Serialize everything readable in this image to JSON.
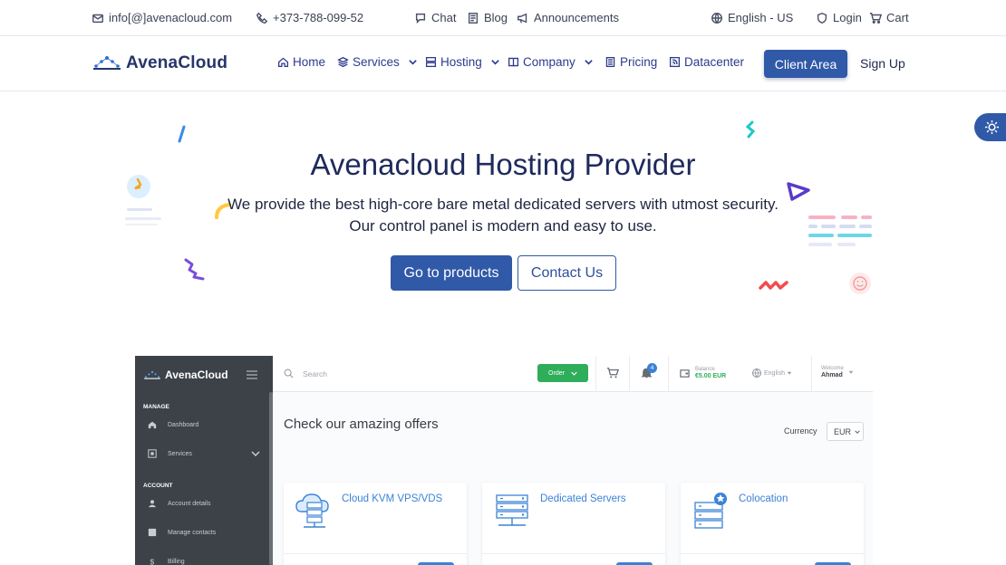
{
  "topbar": {
    "email": "info[@]avenacloud.com",
    "phone": "+373-788-099-52",
    "chat": "Chat",
    "blog": "Blog",
    "announcements": "Announcements",
    "language": "English - US",
    "login": "Login",
    "cart": "Cart"
  },
  "nav": {
    "logo": "AvenaCloud",
    "items": [
      {
        "label": "Home",
        "icon": "home-icon"
      },
      {
        "label": "Services",
        "icon": "layers-icon"
      },
      {
        "label": "Hosting",
        "icon": "server-icon"
      },
      {
        "label": "Company",
        "icon": "book-icon"
      },
      {
        "label": "Pricing",
        "icon": "document-icon"
      },
      {
        "label": "Datacenter",
        "icon": "rss-icon"
      }
    ],
    "client_area": "Client Area",
    "sign_up": "Sign Up"
  },
  "hero": {
    "title": "Avenacloud Hosting Provider",
    "subtitle": "We provide the best high-core bare metal dedicated servers with utmost security. Our control panel is modern and easy to use.",
    "primary_button": "Go to products",
    "secondary_button": "Contact Us"
  },
  "preview": {
    "logo": "AvenaCloud",
    "sidebar": {
      "manage_section": "MANAGE",
      "account_section": "ACCOUNT",
      "links": [
        "Dashboard",
        "Services",
        "Account details",
        "Manage contacts",
        "Billing"
      ]
    },
    "topbar": {
      "search_placeholder": "Search",
      "order": "Order",
      "notifications": "4",
      "balance_label": "Balance",
      "balance_value": "€5.00 EUR",
      "language": "English",
      "welcome_label": "Welcome",
      "user": "Ahmad"
    },
    "main_title": "Check our amazing offers",
    "currency_label": "Currency",
    "currency_value": "EUR",
    "cards": [
      "Cloud KVM VPS/VDS",
      "Dedicated Servers",
      "Colocation"
    ]
  },
  "colors": {
    "primary": "#3059a8",
    "navy": "#1e2a5c",
    "order_green": "#2eae5a",
    "card_blue": "#3b82d6"
  }
}
